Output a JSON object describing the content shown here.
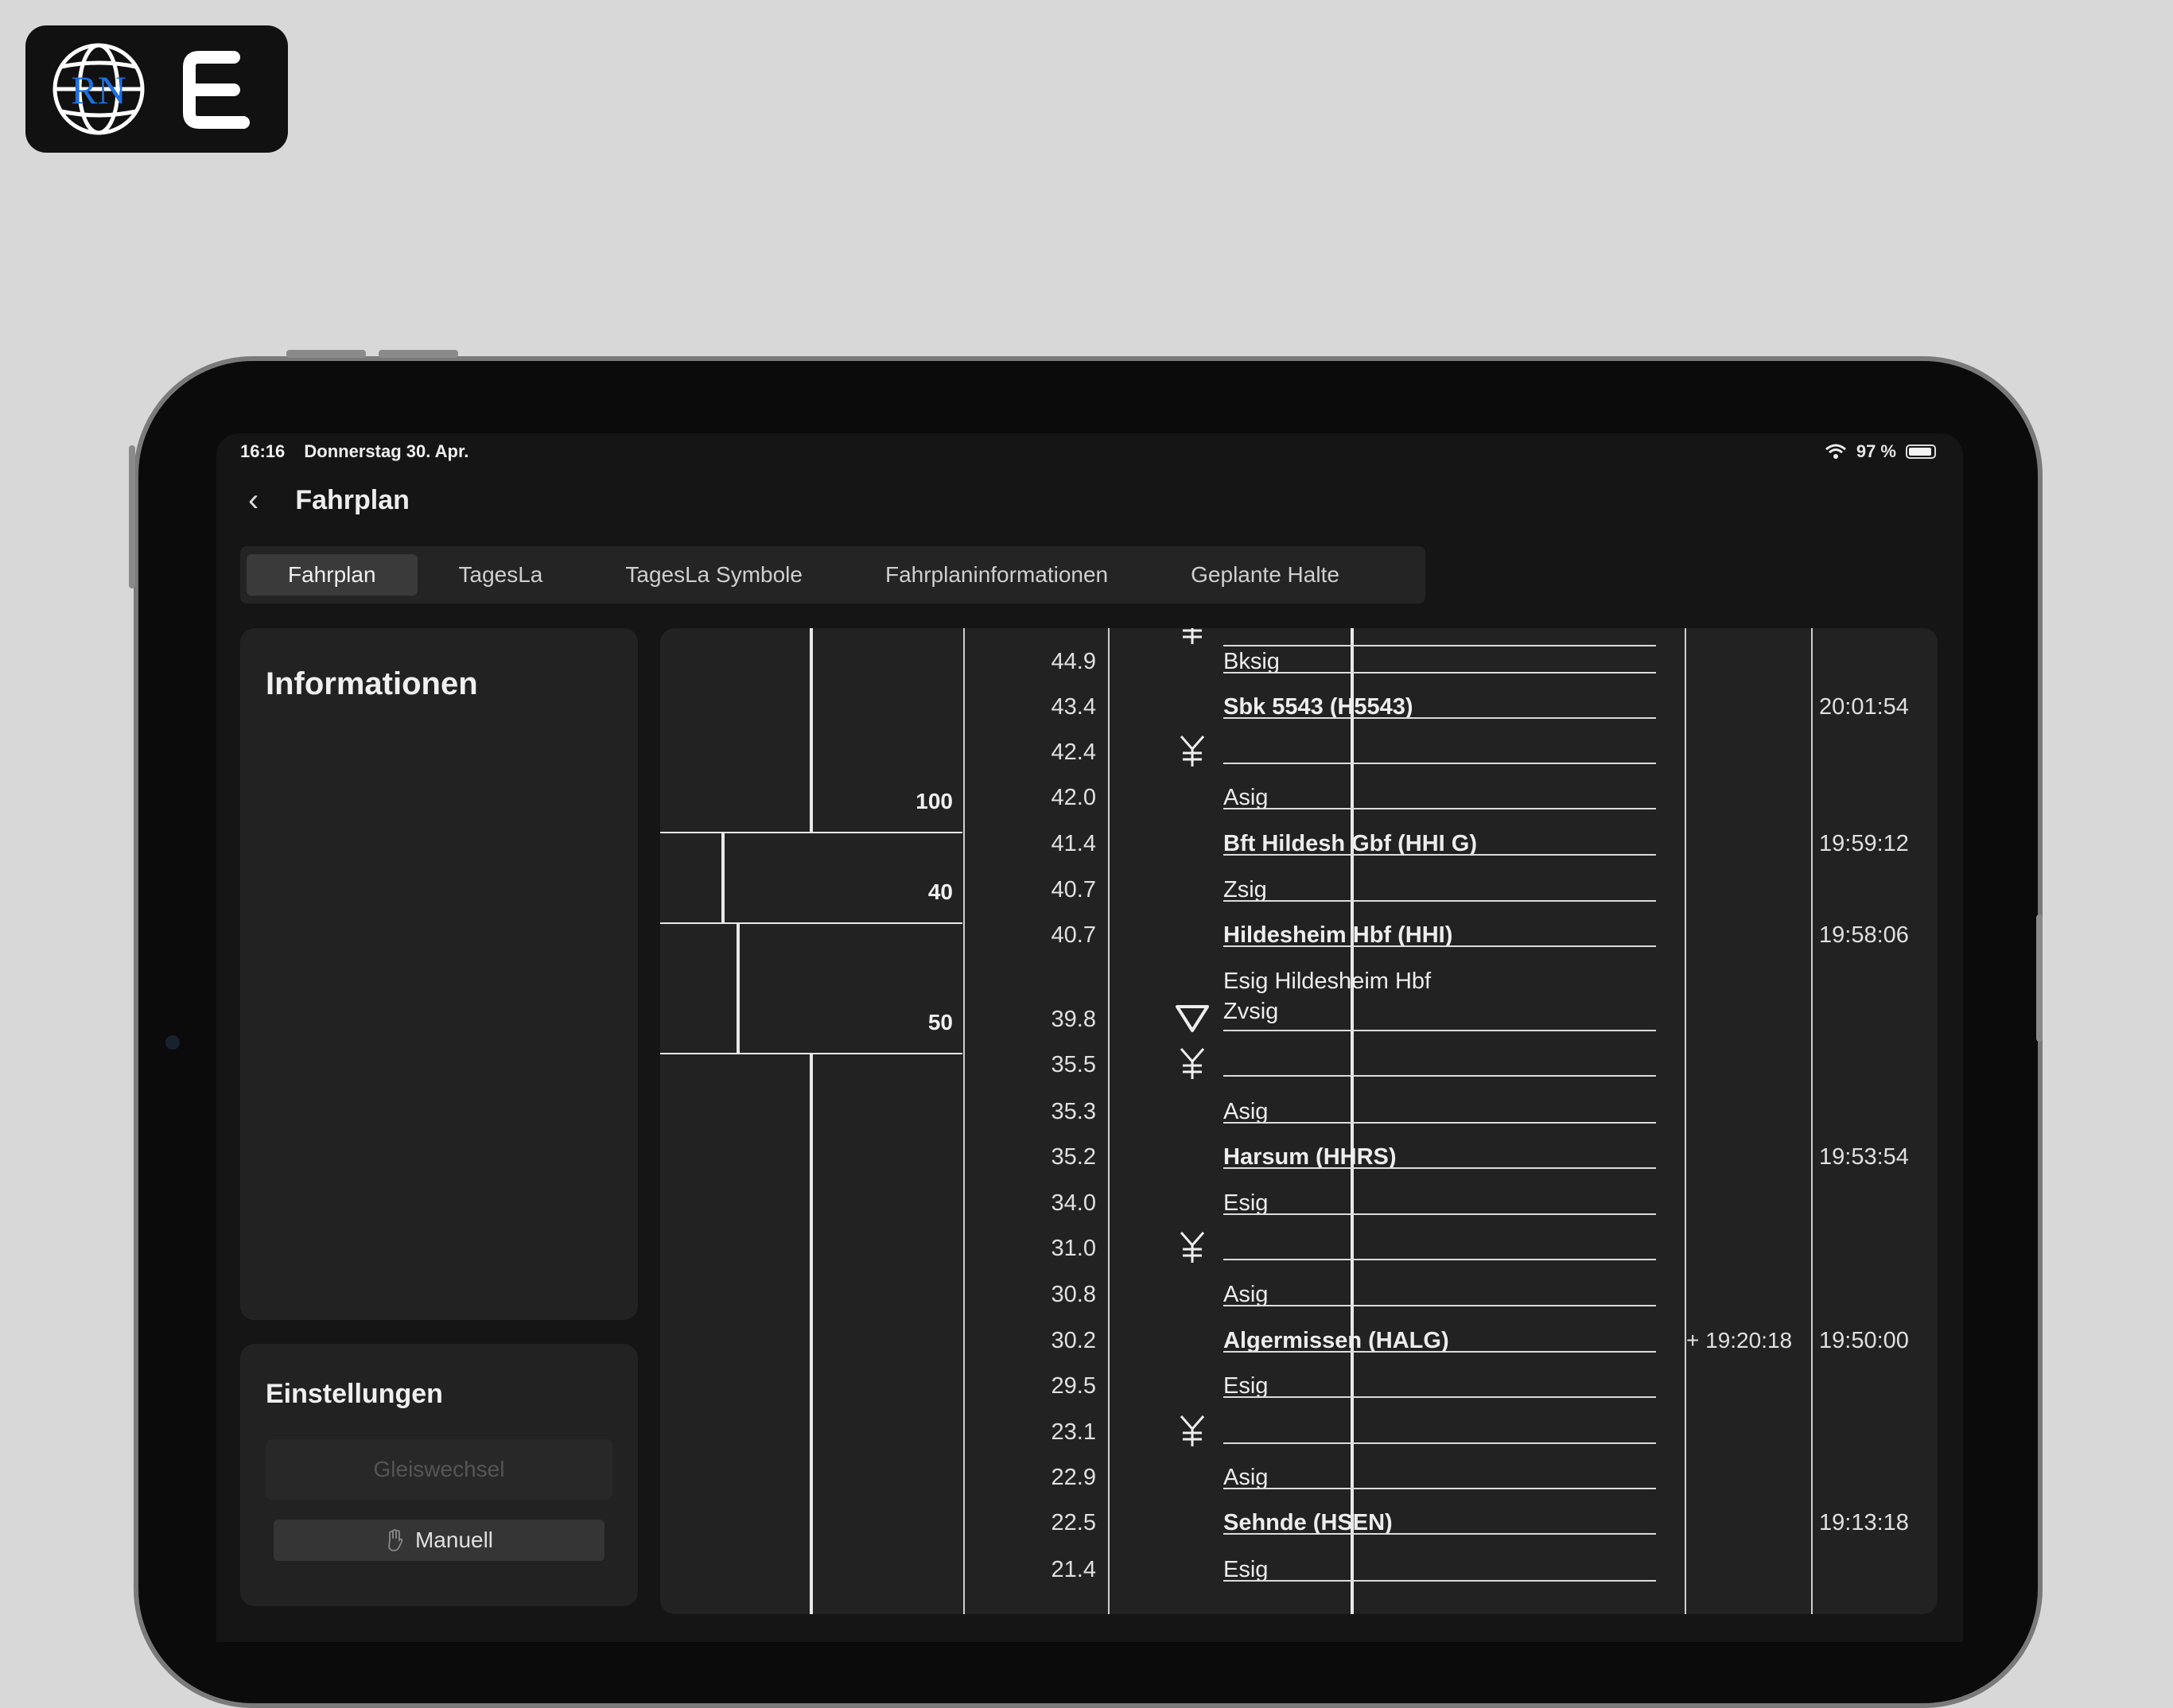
{
  "status_bar": {
    "time": "16:16",
    "date": "Donnerstag 30. Apr.",
    "battery": "97 %"
  },
  "header": {
    "title": "Fahrplan"
  },
  "tabs": [
    {
      "label": "Fahrplan",
      "active": true
    },
    {
      "label": "TagesLa",
      "active": false
    },
    {
      "label": "TagesLa Symbole",
      "active": false
    },
    {
      "label": "Fahrplaninformationen",
      "active": false
    },
    {
      "label": "Geplante Halte",
      "active": false
    }
  ],
  "info_panel": {
    "title": "Informationen"
  },
  "settings_panel": {
    "title": "Einstellungen",
    "track_change_label": "Gleiswechsel",
    "manual_label": "Manuell"
  },
  "speeds": [
    {
      "value": "100"
    },
    {
      "value": "40"
    },
    {
      "value": "50"
    }
  ],
  "rows": [
    {
      "km": "44.9",
      "name": "Bksig",
      "bold": false,
      "time": "",
      "extra": ""
    },
    {
      "km": "43.4",
      "name": "Sbk 5543 (H5543)",
      "bold": true,
      "time": "20:01:54",
      "extra": ""
    },
    {
      "km": "42.4",
      "name": "",
      "bold": false,
      "time": "",
      "extra": "",
      "symbol": "switch-icon"
    },
    {
      "km": "42.0",
      "name": "Asig",
      "bold": false,
      "time": "",
      "extra": ""
    },
    {
      "km": "41.4",
      "name": "Bft Hildesh Gbf (HHI G)",
      "bold": true,
      "time": "19:59:12",
      "extra": ""
    },
    {
      "km": "40.7",
      "name": "Zsig",
      "bold": false,
      "time": "",
      "extra": ""
    },
    {
      "km": "40.7",
      "name": "Hildesheim Hbf (HHI)",
      "bold": true,
      "time": "19:58:06",
      "extra": ""
    },
    {
      "km": "",
      "name": "Esig Hildesheim Hbf",
      "bold": false,
      "time": "",
      "extra": ""
    },
    {
      "km": "39.8",
      "name": "Zvsig",
      "bold": false,
      "time": "",
      "extra": "",
      "symbol": "triangle-icon"
    },
    {
      "km": "35.5",
      "name": "",
      "bold": false,
      "time": "",
      "extra": "",
      "symbol": "switch-icon"
    },
    {
      "km": "35.3",
      "name": "Asig",
      "bold": false,
      "time": "",
      "extra": ""
    },
    {
      "km": "35.2",
      "name": "Harsum (HHRS)",
      "bold": true,
      "time": "19:53:54",
      "extra": ""
    },
    {
      "km": "34.0",
      "name": "Esig",
      "bold": false,
      "time": "",
      "extra": ""
    },
    {
      "km": "31.0",
      "name": "",
      "bold": false,
      "time": "",
      "extra": "",
      "symbol": "switch-icon"
    },
    {
      "km": "30.8",
      "name": "Asig",
      "bold": false,
      "time": "",
      "extra": ""
    },
    {
      "km": "30.2",
      "name": "Algermissen (HALG)",
      "bold": true,
      "time": "19:50:00",
      "extra": "+ 19:20:18"
    },
    {
      "km": "29.5",
      "name": "Esig",
      "bold": false,
      "time": "",
      "extra": ""
    },
    {
      "km": "23.1",
      "name": "",
      "bold": false,
      "time": "",
      "extra": "",
      "symbol": "switch-icon"
    },
    {
      "km": "22.9",
      "name": "Asig",
      "bold": false,
      "time": "",
      "extra": ""
    },
    {
      "km": "22.5",
      "name": "Sehnde (HSEN)",
      "bold": true,
      "time": "19:13:18",
      "extra": ""
    },
    {
      "km": "21.4",
      "name": "Esig",
      "bold": false,
      "time": "",
      "extra": ""
    }
  ]
}
